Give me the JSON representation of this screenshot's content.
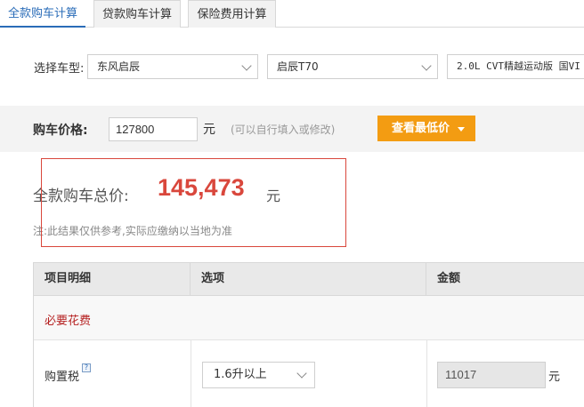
{
  "tabs": [
    {
      "label": "全款购车计算",
      "active": true
    },
    {
      "label": "贷款购车计算",
      "active": false
    },
    {
      "label": "保险费用计算",
      "active": false
    }
  ],
  "selector": {
    "label": "选择车型:",
    "brand": "东风启辰",
    "series": "启辰T70",
    "model": "2.0L CVT精越运动版 国VI"
  },
  "price": {
    "label": "购车价格:",
    "value": "127800",
    "unit": "元",
    "hint": "(可以自行填入或修改)",
    "lowest_button": "查看最低价"
  },
  "total": {
    "label": "全款购车总价:",
    "value": "145,473",
    "unit": "元",
    "note": "注:此结果仅供参考,实际应缴纳以当地为准"
  },
  "table": {
    "headers": [
      "项目明细",
      "选项",
      "金额"
    ],
    "section": "必要花费",
    "rows": [
      {
        "label": "购置税",
        "help_icon": "question-icon",
        "option": "1.6升以上",
        "amount": "11017",
        "unit": "元"
      }
    ]
  },
  "colors": {
    "accent_blue": "#2a6cb8",
    "orange_button": "#f39c12",
    "total_red": "#d9473c",
    "section_red": "#b52020"
  }
}
